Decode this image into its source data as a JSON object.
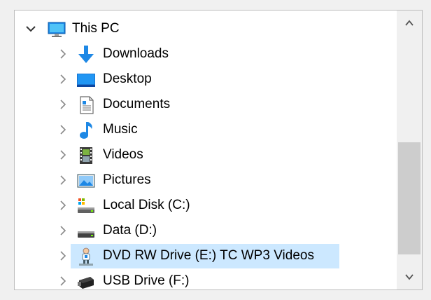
{
  "tree": {
    "root": {
      "label": "This PC",
      "expanded": true,
      "icon": "monitor-icon"
    },
    "items": [
      {
        "label": "Downloads",
        "icon": "downloads-icon",
        "selected": false
      },
      {
        "label": "Desktop",
        "icon": "desktop-icon",
        "selected": false
      },
      {
        "label": "Documents",
        "icon": "documents-icon",
        "selected": false
      },
      {
        "label": "Music",
        "icon": "music-icon",
        "selected": false
      },
      {
        "label": "Videos",
        "icon": "videos-icon",
        "selected": false
      },
      {
        "label": "Pictures",
        "icon": "pictures-icon",
        "selected": false
      },
      {
        "label": "Local Disk (C:)",
        "icon": "local-disk-icon",
        "selected": false
      },
      {
        "label": "Data (D:)",
        "icon": "drive-icon",
        "selected": false
      },
      {
        "label": "DVD RW Drive (E:) TC WP3 Videos",
        "icon": "dvd-drive-icon",
        "selected": true
      },
      {
        "label": "USB Drive (F:)",
        "icon": "usb-drive-icon",
        "selected": false
      }
    ]
  },
  "colors": {
    "selection": "#cce8ff",
    "accent_blue": "#1e88e5"
  },
  "scrollbar": {
    "up_icon": "chevron-up-icon",
    "down_icon": "chevron-down-icon"
  }
}
